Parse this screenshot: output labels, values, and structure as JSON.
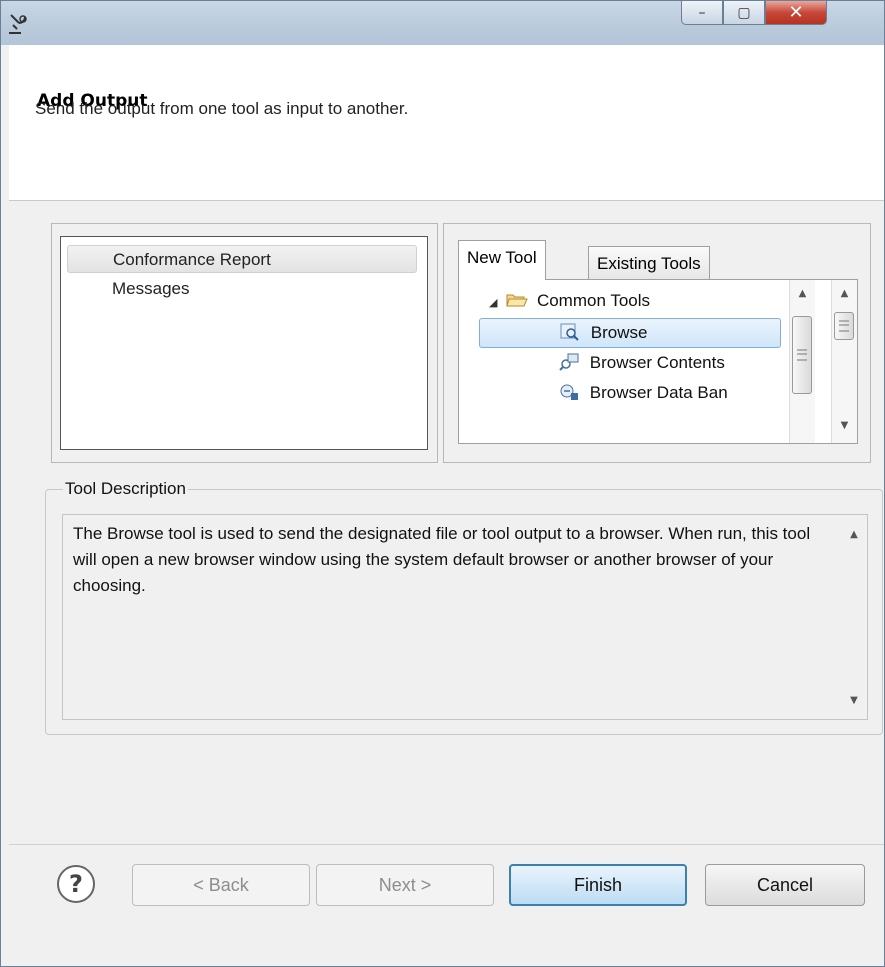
{
  "window": {
    "title": "",
    "controls": {
      "minimize": "–",
      "maximize": "▢",
      "close": "✕"
    }
  },
  "header": {
    "title": "Add Output",
    "subtitle": "Send the output from one tool as input to another."
  },
  "output_list": {
    "items": [
      {
        "label": "Conformance Report",
        "selected": true
      },
      {
        "label": "Messages",
        "selected": false
      }
    ]
  },
  "tool_tabs": {
    "tabs": [
      {
        "label": "New Tool",
        "active": true
      },
      {
        "label": "Existing Tools",
        "active": false
      }
    ]
  },
  "tool_tree": {
    "folder": "Common Tools",
    "items": [
      {
        "label": "Browse",
        "icon": "browse-icon",
        "selected": true
      },
      {
        "label": "Browser Contents",
        "icon": "browser-contents-icon",
        "selected": false
      },
      {
        "label": "Browser Data Ban",
        "icon": "browser-data-icon",
        "selected": false
      }
    ]
  },
  "description": {
    "legend": "Tool Description",
    "text": "The Browse tool is used to send the designated file or tool output to a browser. When run, this tool will open a new browser window using the system default browser or another browser of your choosing."
  },
  "footer": {
    "help": "?",
    "back": "< Back",
    "next": "Next >",
    "finish": "Finish",
    "cancel": "Cancel"
  }
}
